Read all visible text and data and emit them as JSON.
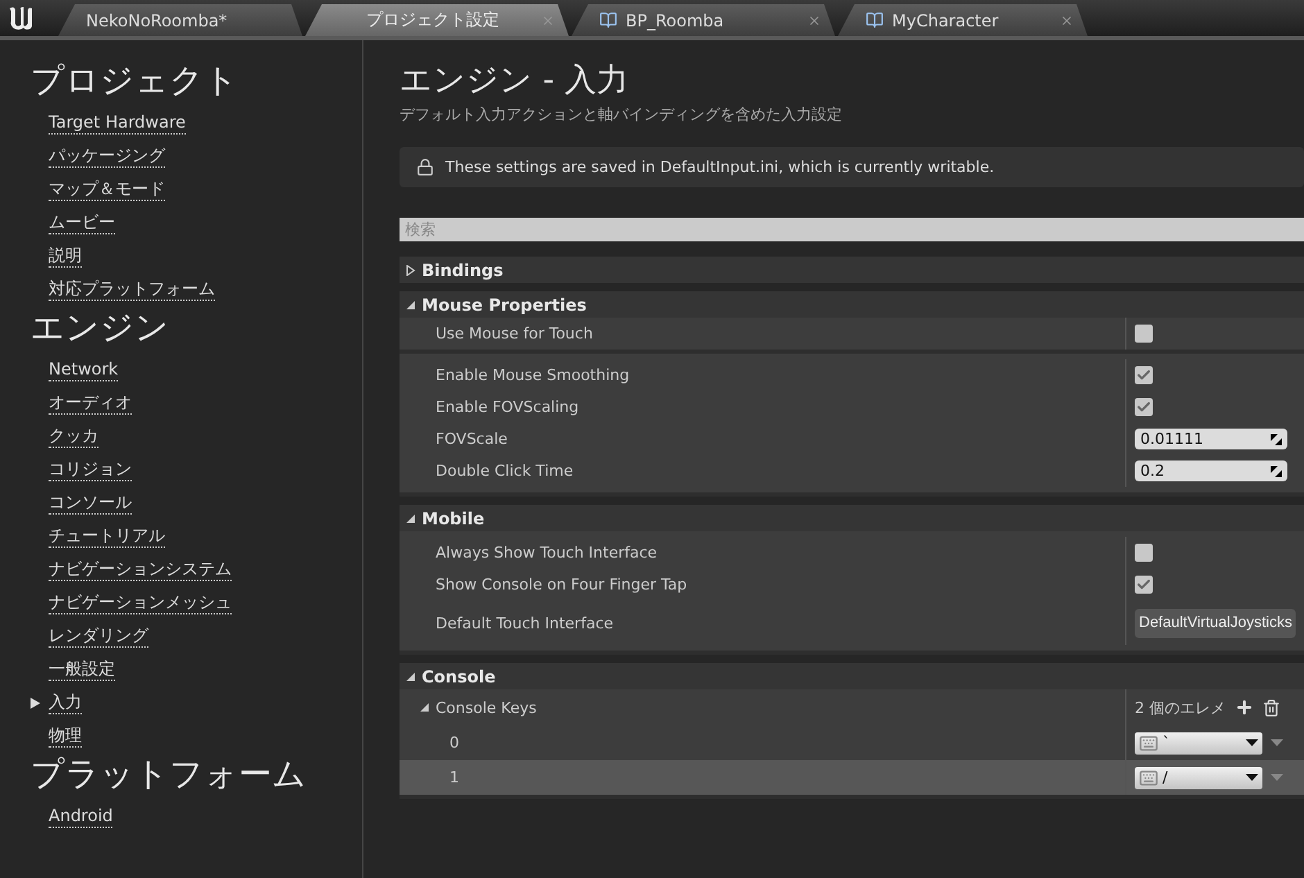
{
  "tabs": [
    {
      "label": "NekoNoRoomba*",
      "selected": false,
      "kind": "level",
      "closable": false
    },
    {
      "label": "プロジェクト設定",
      "selected": true,
      "kind": "settings",
      "closable": true
    },
    {
      "label": "BP_Roomba",
      "selected": false,
      "kind": "blueprint",
      "closable": true
    },
    {
      "label": "MyCharacter",
      "selected": false,
      "kind": "blueprint",
      "closable": true
    }
  ],
  "sidebar": [
    {
      "heading": "プロジェクト",
      "items": [
        {
          "label": "Target Hardware",
          "selected": false
        },
        {
          "label": "パッケージング",
          "selected": false
        },
        {
          "label": "マップ＆モード",
          "selected": false
        },
        {
          "label": "ムービー",
          "selected": false
        },
        {
          "label": "説明",
          "selected": false
        },
        {
          "label": "対応プラットフォーム",
          "selected": false
        }
      ]
    },
    {
      "heading": "エンジン",
      "items": [
        {
          "label": "Network",
          "selected": false
        },
        {
          "label": "オーディオ",
          "selected": false
        },
        {
          "label": "クッカ",
          "selected": false
        },
        {
          "label": "コリジョン",
          "selected": false
        },
        {
          "label": "コンソール",
          "selected": false
        },
        {
          "label": "チュートリアル",
          "selected": false
        },
        {
          "label": "ナビゲーションシステム",
          "selected": false
        },
        {
          "label": "ナビゲーションメッシュ",
          "selected": false
        },
        {
          "label": "レンダリング",
          "selected": false
        },
        {
          "label": "一般設定",
          "selected": false
        },
        {
          "label": "入力",
          "selected": true
        },
        {
          "label": "物理",
          "selected": false
        }
      ]
    },
    {
      "heading": "プラットフォーム",
      "items": [
        {
          "label": "Android",
          "selected": false
        }
      ]
    }
  ],
  "page": {
    "title": "エンジン - 入力",
    "subtitle": "デフォルト入力アクションと軸バインディングを含めた入力設定",
    "notice": "These settings are saved in DefaultInput.ini, which is currently writable.",
    "search": {
      "placeholder": "検索"
    }
  },
  "sections": [
    {
      "title": "Bindings",
      "expanded": false
    },
    {
      "title": "Mouse Properties",
      "expanded": true,
      "groups": [
        [
          {
            "kind": "checkbox",
            "label": "Use Mouse for Touch",
            "checked": false
          }
        ],
        [
          {
            "kind": "checkbox",
            "label": "Enable Mouse Smoothing",
            "checked": true
          },
          {
            "kind": "checkbox",
            "label": "Enable FOVScaling",
            "checked": true
          },
          {
            "kind": "number",
            "label": "FOVScale",
            "value": "0.01111"
          },
          {
            "kind": "number",
            "label": "Double Click Time",
            "value": "0.2"
          }
        ]
      ]
    },
    {
      "title": "Mobile",
      "expanded": true,
      "groups": [
        [
          {
            "kind": "checkbox",
            "label": "Always Show Touch Interface",
            "checked": false
          },
          {
            "kind": "checkbox",
            "label": "Show Console on Four Finger Tap",
            "checked": true
          },
          {
            "kind": "dropdown",
            "label": "Default Touch Interface",
            "value": "DefaultVirtualJoysticks"
          }
        ]
      ]
    },
    {
      "title": "Console",
      "expanded": true,
      "groups": [
        [
          {
            "kind": "array",
            "label": "Console Keys",
            "expanded": true,
            "count": "2 個のエレメ",
            "children": [
              {
                "label": "0",
                "value": "`",
                "selected": false
              },
              {
                "label": "1",
                "value": "/",
                "selected": true
              }
            ]
          }
        ]
      ]
    }
  ]
}
